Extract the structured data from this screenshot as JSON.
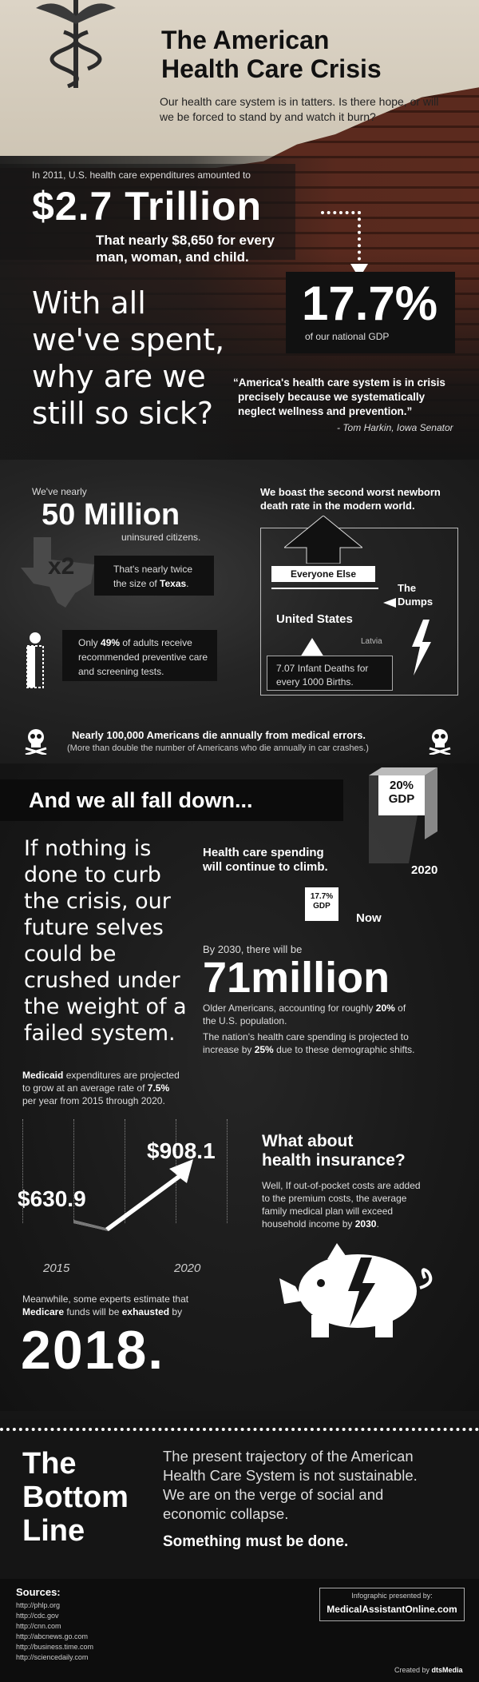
{
  "header": {
    "title_line1": "The American",
    "title_line2": "Health Care Crisis",
    "subtitle_line1": "Our health care system is in tatters. Is there hope, or will",
    "subtitle_line2": "we be forced to stand by and watch it burn?"
  },
  "spending": {
    "intro": "In 2011, U.S. health care expenditures amounted to",
    "amount": "$2.7 Trillion",
    "per_person_line1": "That nearly $8,650 for every",
    "per_person_line2": "man, woman, and child.",
    "gdp_percent": "17.7%",
    "gdp_label": "of our national GDP"
  },
  "question": {
    "line1": "With all",
    "line2": "we've spent,",
    "line3": "why are we",
    "line4": "still so sick?"
  },
  "quote": {
    "line1": "“America's health care system is in crisis",
    "line2": "precisely because we systematically",
    "line3": "neglect wellness and prevention.”",
    "attribution": "- Tom Harkin, Iowa Senator"
  },
  "uninsured": {
    "prefix": "We've nearly",
    "number": "50 Million",
    "suffix": "uninsured citizens.",
    "multiplier": "x2",
    "texas_line1": "That's nearly twice",
    "texas_line2_pre": "the size of ",
    "texas_line2_bold": "Texas",
    "texas_line2_post": "."
  },
  "preventive": {
    "line1_pre": "Only ",
    "line1_bold": "49%",
    "line1_post": " of adults receive",
    "line2": "recommended preventive care",
    "line3": "and screening tests."
  },
  "newborn": {
    "heading_line1": "We boast the second worst newborn",
    "heading_line2": "death rate in the modern world.",
    "everyone_else": "Everyone Else",
    "the_dumps_line1": "The",
    "the_dumps_line2": "Dumps",
    "united_states": "United States",
    "latvia": "Latvia",
    "deaths_line1": "7.07 Infant Deaths for",
    "deaths_line2": "every 1000 Births."
  },
  "errors": {
    "line1": "Nearly 100,000 Americans die annually from medical errors.",
    "line2": "(More than double the number of Americans who die annually in car crashes.)"
  },
  "fall_down": {
    "banner": "And we all fall down...",
    "left_line1": "If nothing is",
    "left_line2": "done to curb",
    "left_line3": "the crisis, our",
    "left_line4": "future selves",
    "left_line5": "could be",
    "left_line6": "crushed under",
    "left_line7": "the weight of a",
    "left_line8": "failed system.",
    "gdp_future_line1": "20%",
    "gdp_future_line2": "GDP",
    "year_future": "2020",
    "climb_line1": "Health care spending",
    "climb_line2": "will continue to climb.",
    "gdp_now_line1": "17.7%",
    "gdp_now_line2": "GDP",
    "now": "Now"
  },
  "older": {
    "prefix": "By 2030, there will be",
    "number": "71million",
    "line1_pre": "Older Americans, accounting for roughly ",
    "line1_bold": "20%",
    "line1_post": " of",
    "line2": "the U.S. population.",
    "line3": "The nation's health care spending is projected to",
    "line4_pre": "increase by ",
    "line4_bold": "25%",
    "line4_post": " due to these demographic shifts."
  },
  "medicaid": {
    "line1_bold": "Medicaid",
    "line1_post": " expenditures are projected",
    "line2_pre": "to grow at an average rate of ",
    "line2_bold": "7.5%",
    "line3": "per year from 2015 through 2020.",
    "value_2015": "$630.9",
    "value_2020": "$908.1",
    "year_2015": "2015",
    "year_2020": "2020"
  },
  "insurance": {
    "heading_line1": "What about",
    "heading_line2": "health insurance?",
    "line1": "Well, If out-of-pocket costs are added",
    "line2": "to the premium costs, the average",
    "line3": "family medical plan will exceed",
    "line4_pre": "household income by ",
    "line4_bold": "2030",
    "line4_post": "."
  },
  "medicare": {
    "line1": "Meanwhile, some experts estimate that",
    "line2_bold1": "Medicare",
    "line2_mid": " funds will be ",
    "line2_bold2": "exhausted",
    "line2_post": " by",
    "year": "2018."
  },
  "bottom_line": {
    "title_line1": "The",
    "title_line2": "Bottom",
    "title_line3": "Line",
    "text_line1": "The present trajectory of the American",
    "text_line2": "Health Care System is not sustainable.",
    "text_line3": "We are on the verge of social and",
    "text_line4": "economic collapse.",
    "emphasis": "Something must be done."
  },
  "sources": {
    "heading": "Sources:",
    "items": [
      "http://phlp.org",
      "http://cdc.gov",
      "http://cnn.com",
      "http://abcnews.go.com",
      "http://business.time.com",
      "http://sciencedaily.com"
    ],
    "presented_by": "Infographic presented by:",
    "site": "MedicalAssistantOnline.com",
    "created_by_pre": "Created by ",
    "created_by": "dtsMedia"
  }
}
